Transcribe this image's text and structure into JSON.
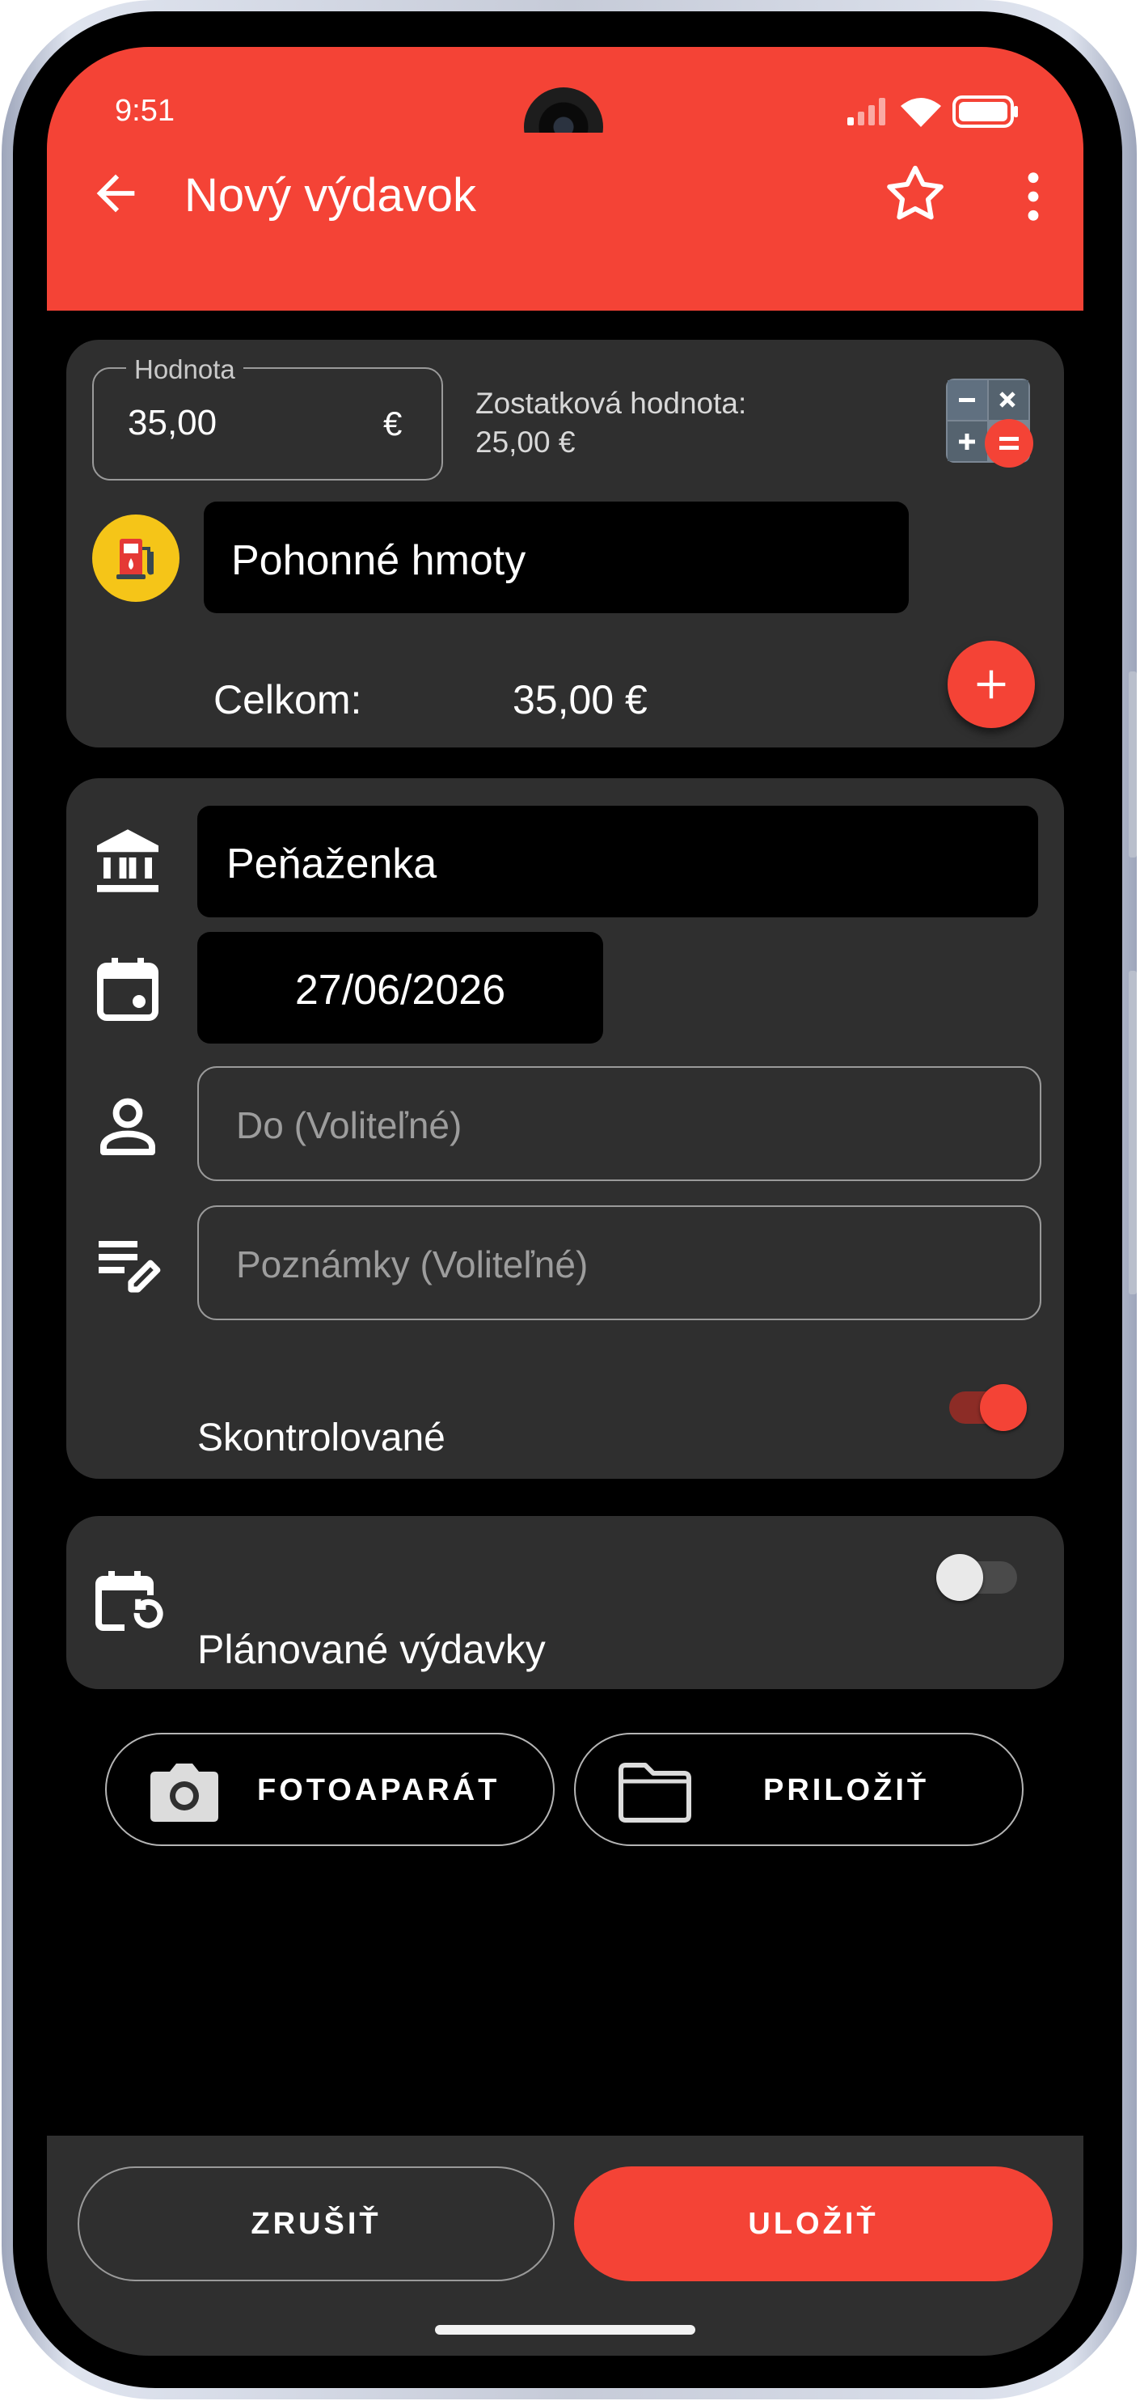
{
  "status_bar": {
    "time": "9:51"
  },
  "app_bar": {
    "title": "Nový výdavok"
  },
  "amount": {
    "label": "Hodnota",
    "value": "35,00",
    "currency": "€",
    "remaining_label": "Zostatková hodnota:",
    "remaining_value": "25,00 €"
  },
  "category": {
    "name": "Pohonné hmoty"
  },
  "total": {
    "label": "Celkom:",
    "value": "35,00 €"
  },
  "account": {
    "name": "Peňaženka"
  },
  "date": {
    "value": "27/06/2026"
  },
  "payee": {
    "placeholder": "Do (Voliteľné)"
  },
  "notes": {
    "placeholder": "Poznámky (Voliteľné)"
  },
  "checked": {
    "label": "Skontrolované",
    "enabled": true
  },
  "planned": {
    "label": "Plánované výdavky",
    "enabled": false
  },
  "attachments": {
    "camera_label": "FOTOAPARÁT",
    "attach_label": "PRILOŽIŤ"
  },
  "actions": {
    "cancel_label": "ZRUŠIŤ",
    "save_label": "ULOŽIŤ"
  },
  "colors": {
    "accent": "#f44336",
    "card": "#2f2f2f",
    "background": "#000000",
    "category_icon_bg": "#f5c518"
  },
  "icons": [
    "arrow-back-icon",
    "star-outline-icon",
    "more-vert-icon",
    "calculator-icon",
    "fuel-pump-icon",
    "plus-icon",
    "bank-icon",
    "calendar-icon",
    "person-icon",
    "notes-edit-icon",
    "calendar-repeat-icon",
    "camera-icon",
    "folder-icon"
  ]
}
